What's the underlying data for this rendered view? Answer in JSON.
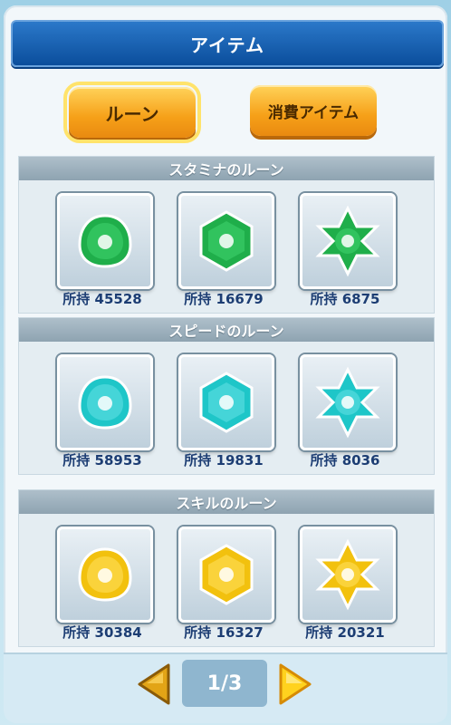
{
  "header": {
    "title": "アイテム"
  },
  "tabs": [
    {
      "label": "ルーン",
      "selected": true
    },
    {
      "label": "消費アイテム",
      "selected": false
    }
  ],
  "sections": [
    {
      "title": "スタミナのルーン",
      "color": "#1fae4a",
      "runes": [
        {
          "shape": "round",
          "count_label": "所持 45528"
        },
        {
          "shape": "hexagon",
          "count_label": "所持 16679"
        },
        {
          "shape": "star",
          "count_label": "所持 6875"
        }
      ]
    },
    {
      "title": "スピードのルーン",
      "color": "#1ec6c8",
      "runes": [
        {
          "shape": "round",
          "count_label": "所持 58953"
        },
        {
          "shape": "hexagon",
          "count_label": "所持 19831"
        },
        {
          "shape": "star",
          "count_label": "所持 8036"
        }
      ]
    },
    {
      "title": "スキルのルーン",
      "color": "#f2c10e",
      "runes": [
        {
          "shape": "round",
          "count_label": "所持 30384"
        },
        {
          "shape": "hexagon",
          "count_label": "所持 16327"
        },
        {
          "shape": "star",
          "count_label": "所持 20321"
        }
      ]
    }
  ],
  "pagination": {
    "page_label": "1/3",
    "prev_icon": "left-arrow-icon",
    "next_icon": "right-arrow-icon"
  }
}
